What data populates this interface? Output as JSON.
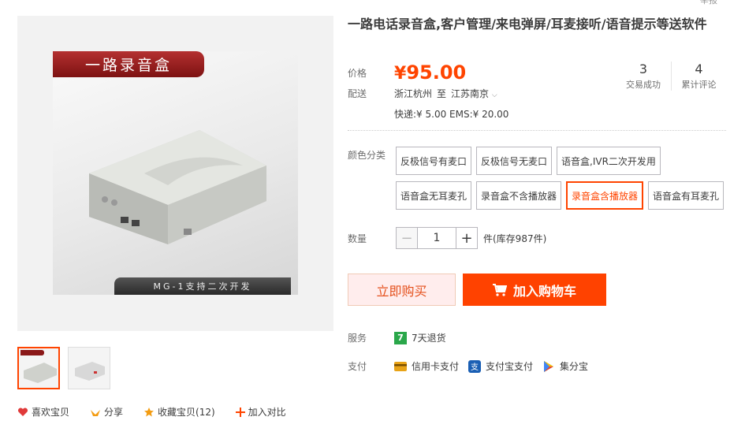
{
  "product": {
    "title": "一路电话录音盒,客户管理/来电弹屏/耳麦接听/语音提示等送软件",
    "corner_text": "举报",
    "banner_text": "一路录音盒",
    "photo_caption": "MG-1支持二次开发"
  },
  "price": {
    "label": "价格",
    "currency": "¥",
    "value": "95.00"
  },
  "stats": [
    {
      "num": "3",
      "caption": "交易成功"
    },
    {
      "num": "4",
      "caption": "累计评论"
    }
  ],
  "shipping": {
    "label": "配送",
    "from": "浙江杭州",
    "to_word": "至",
    "to": "江苏南京",
    "fees": "快递:¥ 5.00   EMS:¥ 20.00"
  },
  "sku": {
    "label": "颜色分类",
    "options": [
      "反极信号有麦口",
      "反极信号无麦口",
      "语音盒,IVR二次开发用",
      "语音盒无耳麦孔",
      "录音盒不含播放器",
      "录音盒含播放器",
      "语音盒有耳麦孔"
    ],
    "selected_index": 5
  },
  "quantity": {
    "label": "数量",
    "minus": "−",
    "plus": "+",
    "value": "1",
    "stock": "件(库存987件)"
  },
  "actions": {
    "buy_label": "立即购买",
    "cart_label": "加入购物车"
  },
  "service": {
    "label": "服务",
    "badge": "7",
    "text": "7天退货"
  },
  "payment": {
    "label": "支付",
    "methods": [
      {
        "name": "信用卡支付",
        "icon": "credit-card-icon",
        "color": "#e8a317"
      },
      {
        "name": "支付宝支付",
        "icon": "alipay-icon",
        "color": "#1a5fb4"
      },
      {
        "name": "集分宝",
        "icon": "jifenbao-icon",
        "color": "#3aa757"
      }
    ]
  },
  "social": [
    {
      "label": "喜欢宝贝",
      "icon": "heart-icon",
      "color": "#e03a3a"
    },
    {
      "label": "分享",
      "icon": "share-icon",
      "color": "#f39c12"
    },
    {
      "label": "收藏宝贝(12)",
      "icon": "star-icon",
      "color": "#f39c12"
    },
    {
      "label": "加入对比",
      "icon": "plus-icon",
      "color": "#f40"
    }
  ],
  "colors": {
    "accent": "#ff4400",
    "buy_bg": "#ffeded",
    "cart_bg": "#ff4200"
  }
}
